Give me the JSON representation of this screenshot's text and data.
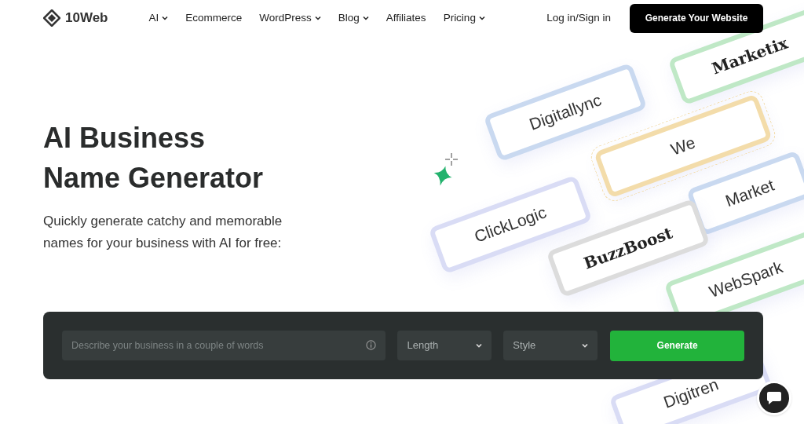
{
  "brand": {
    "name": "10Web"
  },
  "nav": [
    {
      "label": "AI",
      "dropdown": true
    },
    {
      "label": "Ecommerce",
      "dropdown": false
    },
    {
      "label": "WordPress",
      "dropdown": true
    },
    {
      "label": "Blog",
      "dropdown": true
    },
    {
      "label": "Affiliates",
      "dropdown": false
    },
    {
      "label": "Pricing",
      "dropdown": true
    }
  ],
  "login": "Log in/Sign in",
  "cta": "Generate Your Website",
  "hero": {
    "title_lines": [
      "AI Business",
      "Name Generator"
    ],
    "subtitle": "Quickly generate catchy and memorable names for your business with AI for free:"
  },
  "form": {
    "placeholder": "Describe your business in a couple of words",
    "selects": [
      {
        "placeholder": "Length"
      },
      {
        "placeholder": "Style"
      }
    ],
    "button": "Generate"
  },
  "tiles": [
    {
      "text": "Marketix",
      "color": "#bfe8c6",
      "kind": "bold",
      "dashed": false
    },
    {
      "text": "Digitallync",
      "color": "#c9d9f0",
      "kind": "plain",
      "dashed": false
    },
    {
      "text": "We",
      "color": "#f3dcaa",
      "kind": "plain",
      "dashed": true
    },
    {
      "text": "ClickLogic",
      "color": "#d9dcf5",
      "kind": "plain",
      "dashed": false
    },
    {
      "text": "Market",
      "color": "#c9d9f0",
      "kind": "plain",
      "dashed": false
    },
    {
      "text": "BuzzBoost",
      "color": "#dcdcdc",
      "kind": "bold",
      "dashed": false
    },
    {
      "text": "WebSpark",
      "color": "#bfe8c6",
      "kind": "plain",
      "dashed": false
    },
    {
      "text": "Digitren",
      "color": "#d9dcf5",
      "kind": "plain",
      "dashed": false
    }
  ]
}
